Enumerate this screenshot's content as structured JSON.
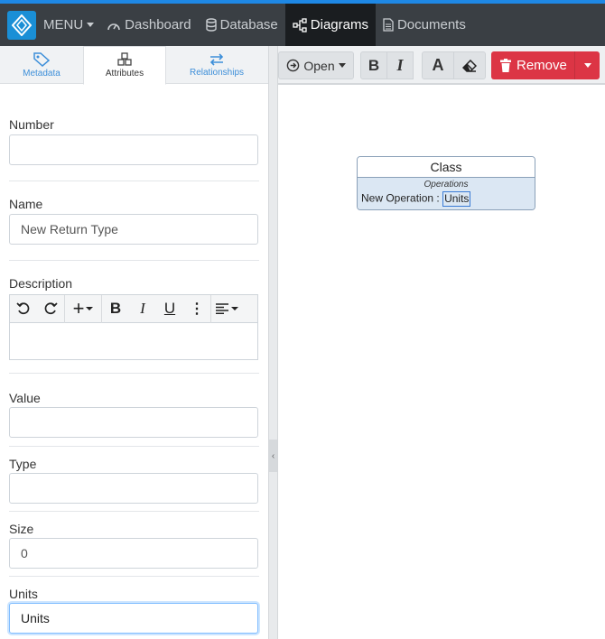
{
  "nav": {
    "menu": "MENU",
    "items": [
      {
        "label": "Dashboard"
      },
      {
        "label": "Database"
      },
      {
        "label": "Diagrams"
      },
      {
        "label": "Documents"
      }
    ]
  },
  "tabs": [
    {
      "label": "Metadata"
    },
    {
      "label": "Attributes"
    },
    {
      "label": "Relationships"
    }
  ],
  "form": {
    "number": {
      "label": "Number",
      "value": ""
    },
    "name": {
      "label": "Name",
      "value": "New Return Type"
    },
    "description": {
      "label": "Description",
      "value": ""
    },
    "value": {
      "label": "Value",
      "value": ""
    },
    "type": {
      "label": "Type",
      "value": ""
    },
    "size": {
      "label": "Size",
      "value": "0"
    },
    "units": {
      "label": "Units",
      "value": "Units"
    }
  },
  "toolbar": {
    "open": "Open",
    "remove": "Remove"
  },
  "diagram": {
    "class_name": "Class",
    "section": "Operations",
    "operation": "New Operation :",
    "operation_type": "Units"
  },
  "colors": {
    "nav_bg": "#3a3f44",
    "accent": "#1e88e5",
    "danger": "#dc3545"
  }
}
